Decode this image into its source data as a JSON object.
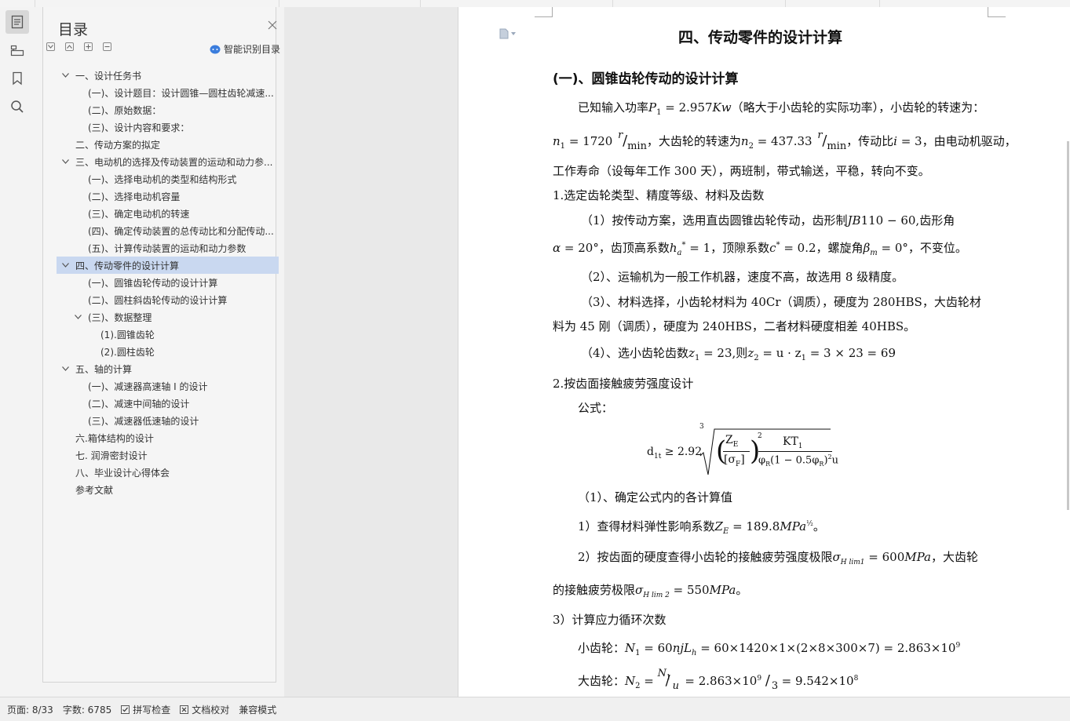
{
  "panel": {
    "title": "目录",
    "smart_toc_label": "智能识别目录"
  },
  "toc": [
    {
      "label": "一、设计任务书",
      "level": 0,
      "caret": "down"
    },
    {
      "label": "(一)、设计题目：设计圆锥—圆柱齿轮减速...",
      "level": 1,
      "caret": ""
    },
    {
      "label": "(二)、原始数据：",
      "level": 1,
      "caret": ""
    },
    {
      "label": "(三)、设计内容和要求：",
      "level": 1,
      "caret": ""
    },
    {
      "label": "二、传动方案的拟定",
      "level": 0,
      "caret": ""
    },
    {
      "label": "三、电动机的选择及传动装置的运动和动力参...",
      "level": 0,
      "caret": "down"
    },
    {
      "label": "(一)、选择电动机的类型和结构形式",
      "level": 1,
      "caret": ""
    },
    {
      "label": "(二)、选择电动机容量",
      "level": 1,
      "caret": ""
    },
    {
      "label": "(三)、确定电动机的转速",
      "level": 1,
      "caret": ""
    },
    {
      "label": "(四)、确定传动装置的总传动比和分配传动...",
      "level": 1,
      "caret": ""
    },
    {
      "label": "(五)、计算传动装置的运动和动力参数",
      "level": 1,
      "caret": ""
    },
    {
      "label": "四、传动零件的设计计算",
      "level": 0,
      "caret": "down",
      "selected": true
    },
    {
      "label": "(一)、圆锥齿轮传动的设计计算",
      "level": 1,
      "caret": ""
    },
    {
      "label": "(二)、圆柱斜齿轮传动的设计计算",
      "level": 1,
      "caret": ""
    },
    {
      "label": "(三)、数据整理",
      "level": 1,
      "caret": "down"
    },
    {
      "label": "(1).圆锥齿轮",
      "level": 2,
      "caret": ""
    },
    {
      "label": "(2).圆柱齿轮",
      "level": 2,
      "caret": ""
    },
    {
      "label": "五、轴的计算",
      "level": 0,
      "caret": "down"
    },
    {
      "label": "(一)、减速器高速轴 I 的设计",
      "level": 1,
      "caret": ""
    },
    {
      "label": "(二)、减速中间轴的设计",
      "level": 1,
      "caret": ""
    },
    {
      "label": "(三)、减速器低速轴的设计",
      "level": 1,
      "caret": ""
    },
    {
      "label": "六.箱体结构的设计",
      "level": 0,
      "caret": ""
    },
    {
      "label": "七. 润滑密封设计",
      "level": 0,
      "caret": ""
    },
    {
      "label": "八、毕业设计心得体会",
      "level": 0,
      "caret": ""
    },
    {
      "label": "参考文献",
      "level": 0,
      "caret": ""
    }
  ],
  "doc": {
    "heading": "四、传动零件的设计计算",
    "subheading": "(一)、圆锥齿轮传动的设计计算",
    "p1a": "已知输入功率",
    "p1_math1": "P",
    "p1_sub1": "1",
    "p1_val1": " = 2.957",
    "p1_unit1": "Kw",
    "p1b": "（略大于小齿轮的实际功率），小齿轮的转速为：",
    "p2_n1": "n",
    "p2_n1sub": "1",
    "p2_n1val": " = 1720",
    "p2_unit": "r",
    "p2_unitden": "min",
    "p2_mid": "，大齿轮的转速为",
    "p2_n2": "n",
    "p2_n2sub": "2",
    "p2_n2val": " = 437.33",
    "p2_mid2": "，传动比",
    "p2_i": "i",
    "p2_ival": " = 3",
    "p2_end": "，由电动机驱动，",
    "p3": "工作寿命（设每年工作 300 天），两班制，带式输送，平稳，转向不变。",
    "s1": "1.选定齿轮类型、精度等级、材料及齿数",
    "s1p1a": "（1）按传动方案，选用直齿圆锥齿轮传动，齿形制",
    "s1p1_jb": "JB",
    "s1p1_jbval": "110 − 60",
    "s1p1b": ",齿形角",
    "s1p2_alpha": "α",
    "s1p2_aval": " = 20°",
    "s1p2_b": "，齿顶高系数",
    "s1p2_h": "h",
    "s1p2_hsub": "a",
    "s1p2_hval": " = 1",
    "s1p2_c": "，顶隙系数",
    "s1p2_cc": "c",
    "s1p2_cval": " = 0.2",
    "s1p2_d": "，螺旋角",
    "s1p2_beta": "β",
    "s1p2_bsub": "m",
    "s1p2_bval": " = 0°",
    "s1p2_e": "，不变位。",
    "s1p3": "（2）、运输机为一般工作机器，速度不高，故选用 8 级精度。",
    "s1p4": "（3）、材料选择，小齿轮材料为 40Cr（调质），硬度为 280HBS，大齿轮材",
    "s1p5": "料为 45 刚（调质），硬度为 240HBS，二者材料硬度相差 40HBS。",
    "s1p6a": "（4）、选小齿轮齿数",
    "s1p6_z1": "z",
    "s1p6_z1sub": "1",
    "s1p6_z1val": " = 23",
    "s1p6_b": ",则",
    "s1p6_z2": "z",
    "s1p6_z2sub": "2",
    "s1p6_z2expr": " = u · z",
    "s1p6_z2expr_sub": "1",
    "s1p6_z2val": " = 3 × 23 = 69",
    "s2": "2.按齿面接触疲劳强度设计",
    "s2p1": "公式：",
    "formula": {
      "lhs": "d",
      "lhs_sub": "1t",
      "rel": "≥ 2.92",
      "root": "3",
      "num1": "Z",
      "num1_sub": "E",
      "den1": "[σ",
      "den1_sub": "F",
      "den1_end": "]",
      "pow": "2",
      "num2": "KT",
      "num2_sub": "1",
      "den2": "φ",
      "den2_sub": "R",
      "den2_mid": "(1 − 0.5φ",
      "den2_sub2": "R",
      "den2_end": ")",
      "den2_pow": "2",
      "den2_u": "u"
    },
    "s2p2": "（1）、确定公式内的各计算值",
    "s2p3a": "1）查得材料弹性影响系数",
    "s2p3_z": "Z",
    "s2p3_zsub": "E",
    "s2p3_val": " = 189.8",
    "s2p3_unit": "MPa",
    "s2p3_pow": "½",
    "s2p3_end": "。",
    "s2p4a": "2）按齿面的硬度查得小齿轮的接触疲劳强度极限",
    "s2p4_sig": "σ",
    "s2p4_sub": "H lim1",
    "s2p4_val": " = 600",
    "s2p4_unit": "MPa",
    "s2p4_end": "，大齿轮",
    "s2p5a": "的接触疲劳极限",
    "s2p5_sig": "σ",
    "s2p5_sub": "H lim 2",
    "s2p5_val": " = 550",
    "s2p5_unit": "MPa",
    "s2p5_end": "。",
    "s2p6": "3）计算应力循环次数",
    "s2p7a": "小齿轮：",
    "s2p7_n": "N",
    "s2p7_sub": "1",
    "s2p7_expr": " = 60",
    "s2p7_njl": "njL",
    "s2p7_hsub": "h",
    "s2p7_val": " = 60×1420×1×(2×8×300×7) = 2.863×10",
    "s2p7_pow": "9",
    "s2p8a": "大齿轮：",
    "s2p8_n": "N",
    "s2p8_sub": "2",
    "s2p8_eq": " = ",
    "s2p8_fn": "N",
    "s2p8_fnsub": "1",
    "s2p8_fd": "u",
    "s2p8_mid": " = 2.863×10",
    "s2p8_pow": "9",
    "s2p8_fd2": "3",
    "s2p8_val": " = 9.542×10",
    "s2p8_pow2": "8"
  },
  "status": {
    "page": "页面: 8/33",
    "words": "字数: 6785",
    "spell": "拼写检查",
    "proof": "文档校对",
    "compat": "兼容模式"
  }
}
